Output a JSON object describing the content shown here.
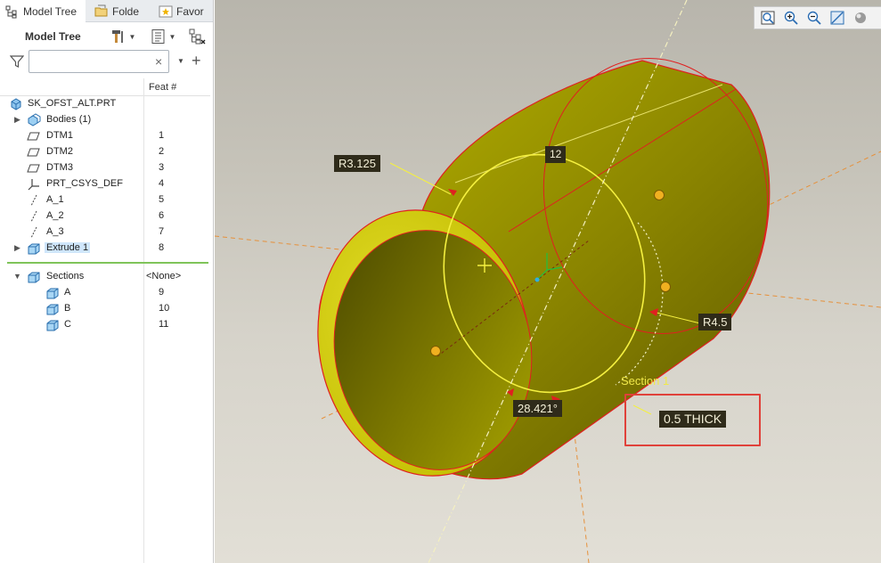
{
  "tabs": [
    {
      "label": "Model Tree",
      "icon": "model-tree-icon",
      "active": true
    },
    {
      "label": "Folde",
      "icon": "folder-browser-icon",
      "active": false
    },
    {
      "label": "Favor",
      "icon": "favorites-icon",
      "active": false
    }
  ],
  "tree_panel": {
    "title": "Model Tree",
    "search": {
      "value": "",
      "placeholder": ""
    },
    "clear_symbol": "×",
    "add_symbol": "+",
    "column_header": "Feat #",
    "items": [
      {
        "label": "SK_OFST_ALT.PRT",
        "feat": "",
        "icon": "part-icon"
      },
      {
        "label": "Bodies (1)",
        "feat": "",
        "icon": "bodies-icon"
      },
      {
        "label": "DTM1",
        "feat": "1",
        "icon": "datum-plane-icon"
      },
      {
        "label": "DTM2",
        "feat": "2",
        "icon": "datum-plane-icon"
      },
      {
        "label": "DTM3",
        "feat": "3",
        "icon": "datum-plane-icon"
      },
      {
        "label": "PRT_CSYS_DEF",
        "feat": "4",
        "icon": "csys-icon"
      },
      {
        "label": "A_1",
        "feat": "5",
        "icon": "datum-axis-icon"
      },
      {
        "label": "A_2",
        "feat": "6",
        "icon": "datum-axis-icon"
      },
      {
        "label": "A_3",
        "feat": "7",
        "icon": "datum-axis-icon"
      },
      {
        "label": "Extrude 1",
        "feat": "8",
        "icon": "extrude-icon",
        "selected": true
      },
      {
        "label": "Sections",
        "feat": "<None>",
        "icon": "sections-icon"
      },
      {
        "label": "A",
        "feat": "9",
        "icon": "section-icon"
      },
      {
        "label": "B",
        "feat": "10",
        "icon": "section-icon"
      },
      {
        "label": "C",
        "feat": "11",
        "icon": "section-icon"
      }
    ]
  },
  "viewport": {
    "dimensions": {
      "r3125": "R3.125",
      "twelve": "12",
      "r45": "R4.5",
      "angle": "28.421°",
      "thick": "0.5 THICK"
    },
    "section_label": "Section 1"
  },
  "colors": {
    "body_yellow": "#c8c400",
    "edge_red": "#e02020",
    "sketch_yellow": "#f5f040",
    "highlight_red": "#e0413a",
    "selection_blue": "#cfe6fb",
    "separator_green": "#7fc45a"
  },
  "view_toolbar_icons": [
    "refit-icon",
    "zoom-in-icon",
    "zoom-out-icon",
    "repaint-icon",
    "display-style-icon"
  ]
}
